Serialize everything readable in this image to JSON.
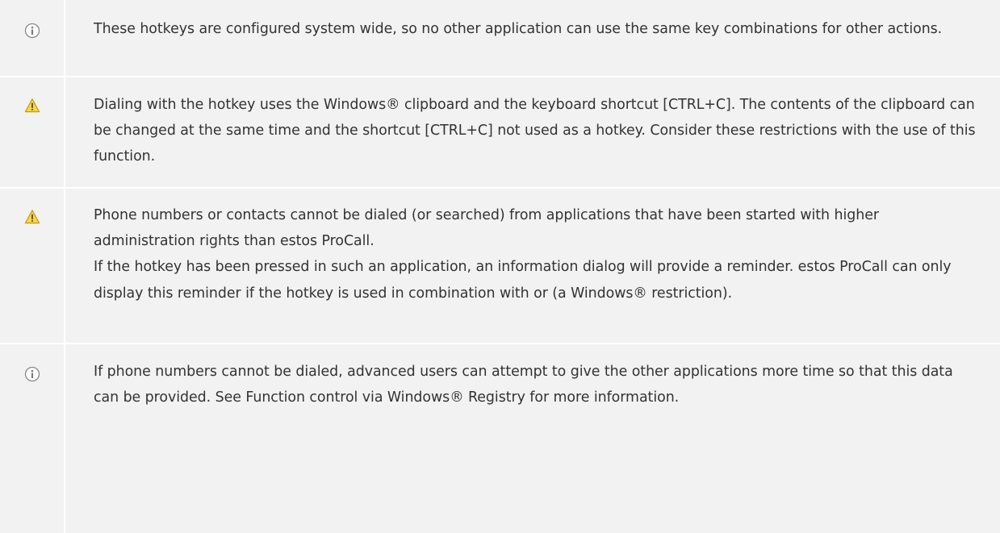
{
  "notes": [
    {
      "type": "info",
      "icon": "info-icon",
      "text": "These hotkeys are configured system wide, so no other application can use the same key combinations for other actions."
    },
    {
      "type": "warning",
      "icon": "warning-icon",
      "text": "Dialing with the hotkey uses the Windows® clipboard and the keyboard shortcut [CTRL+C]. The contents of the clipboard can be changed at the same time and the shortcut [CTRL+C] not used as a hotkey. Consider these restrictions with the use of this function."
    },
    {
      "type": "warning",
      "icon": "warning-icon",
      "text": "Phone numbers or contacts cannot be dialed (or searched) from applications that have been started with higher administration rights than estos ProCall.\nIf the hotkey has been pressed in such an application, an information dialog will provide a reminder. estos ProCall can only display this reminder if the hotkey is used in combination with or (a Windows® restriction)."
    },
    {
      "type": "info",
      "icon": "info-icon",
      "text": "If phone numbers cannot be dialed, advanced users can attempt to give the other applications more time so that this data can be provided. See Function control via Windows® Registry for more information."
    }
  ],
  "colors": {
    "background": "#f2f2f2",
    "divider": "#ffffff",
    "text": "#333333",
    "info_icon": "#8a8a8a",
    "warning_fill": "#f6d54a",
    "warning_stroke": "#c89a10"
  }
}
